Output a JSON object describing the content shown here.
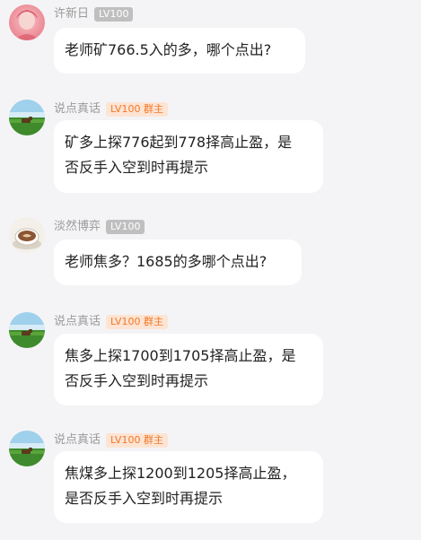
{
  "messages": [
    {
      "avatar": "pink-portrait-avatar",
      "name": "许新日",
      "level": "LV100",
      "role": "",
      "text": "老师矿766.5入的多，哪个点出?"
    },
    {
      "avatar": "landscape-cow-avatar",
      "name": "说点真话",
      "level": "LV100",
      "role": "群主",
      "text": "矿多上探776起到778择高止盈，是\n否反手入空到时再提示"
    },
    {
      "avatar": "coffee-cup-avatar",
      "name": "淡然博弈",
      "level": "LV100",
      "role": "",
      "text": "老师焦多？1685的多哪个点出?"
    },
    {
      "avatar": "landscape-cow-avatar",
      "name": "说点真话",
      "level": "LV100",
      "role": "群主",
      "text": "焦多上探1700到1705择高止盈，是\n否反手入空到时再提示"
    },
    {
      "avatar": "landscape-cow-avatar",
      "name": "说点真话",
      "level": "LV100",
      "role": "群主",
      "text": "焦煤多上探1200到1205择高止盈，\n是否反手入空到时再提示"
    }
  ],
  "colors": {
    "background": "#f4f4f6",
    "bubble": "#ffffff",
    "host_badge_bg": "#fde4d3",
    "host_badge_text": "#f0782a",
    "level_badge_bg": "#bfbfbf"
  }
}
